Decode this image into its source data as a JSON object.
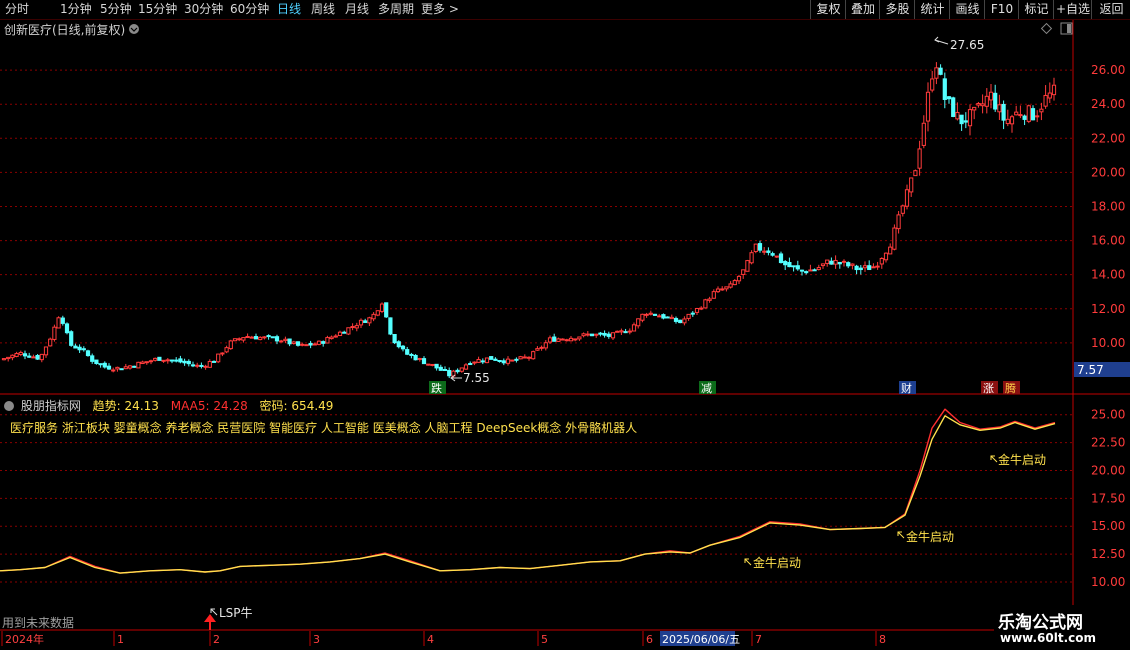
{
  "toolbar": {
    "periods": [
      {
        "label": "分时",
        "active": false
      },
      {
        "label": "1分钟",
        "active": false
      },
      {
        "label": "5分钟",
        "active": false
      },
      {
        "label": "15分钟",
        "active": false
      },
      {
        "label": "30分钟",
        "active": false
      },
      {
        "label": "60分钟",
        "active": false
      },
      {
        "label": "日线",
        "active": true
      },
      {
        "label": "周线",
        "active": false
      },
      {
        "label": "月线",
        "active": false
      },
      {
        "label": "多周期",
        "active": false
      },
      {
        "label": "更多 >",
        "active": false
      }
    ],
    "right_buttons": [
      "复权",
      "叠加",
      "多股",
      "统计",
      "画线",
      "F10",
      "标记",
      "+自选",
      "返回"
    ]
  },
  "main_chart": {
    "title": "创新医疗(日线,前复权)",
    "price_ticks": [
      "26.00",
      "24.00",
      "22.00",
      "20.00",
      "18.00",
      "16.00",
      "14.00",
      "12.00",
      "10.00"
    ],
    "high_annotation": "27.65",
    "low_annotation": "7.55",
    "current_price": "7.57",
    "markers": [
      "跌",
      "减",
      "财",
      "涨",
      "腾"
    ]
  },
  "indicator": {
    "name": "股朋指标网",
    "trend_label": "趋势:",
    "trend_value": "24.13",
    "maa5_label": "MAA5:",
    "maa5_value": "24.28",
    "code_label": "密码:",
    "code_value": "654.49",
    "concepts": "医疗服务 浙江板块 婴童概念 养老概念 民营医院 智能医疗 人工智能 医美概念 人脑工程 DeepSeek概念 外骨骼机器人",
    "ticks": [
      "25.00",
      "22.50",
      "20.00",
      "17.50",
      "15.00",
      "12.50",
      "10.00"
    ],
    "signals": [
      "金牛启动",
      "金牛启动",
      "金牛启动",
      "LSP牛"
    ],
    "future_note": "用到未来数据"
  },
  "timeline": {
    "labels": [
      "2024年",
      "1",
      "2",
      "3",
      "4",
      "5",
      "6",
      "7",
      "8"
    ],
    "selected_date": "2025/06/06/五"
  },
  "watermark": {
    "site_name": "乐淘公式网",
    "site_url": "www.60lt.com"
  },
  "colors": {
    "up": "#ff3b3b",
    "down": "#54ffff",
    "grid": "#7a0000",
    "trend": "#ffe14d",
    "maa5": "#ff3030",
    "price_box": "#1f3f8f"
  },
  "chart_data": [
    {
      "type": "candlestick",
      "title": "创新医疗(日线,前复权)",
      "ylim": [
        7.0,
        28.0
      ],
      "ticks": [
        10,
        12,
        14,
        16,
        18,
        20,
        22,
        24,
        26
      ],
      "close_path": [
        [
          0,
          9.0
        ],
        [
          20,
          9.4
        ],
        [
          40,
          9.1
        ],
        [
          52,
          10.5
        ],
        [
          60,
          11.8
        ],
        [
          70,
          9.9
        ],
        [
          82,
          9.6
        ],
        [
          92,
          9.0
        ],
        [
          104,
          8.6
        ],
        [
          120,
          8.5
        ],
        [
          140,
          8.8
        ],
        [
          160,
          9.1
        ],
        [
          180,
          8.9
        ],
        [
          200,
          8.6
        ],
        [
          215,
          9.0
        ],
        [
          230,
          10.0
        ],
        [
          245,
          10.4
        ],
        [
          262,
          10.3
        ],
        [
          280,
          10.2
        ],
        [
          300,
          9.8
        ],
        [
          320,
          10.0
        ],
        [
          340,
          10.6
        ],
        [
          360,
          11.2
        ],
        [
          372,
          11.5
        ],
        [
          382,
          12.4
        ],
        [
          392,
          10.3
        ],
        [
          405,
          9.4
        ],
        [
          420,
          9.0
        ],
        [
          435,
          8.6
        ],
        [
          450,
          8.1
        ],
        [
          470,
          8.9
        ],
        [
          490,
          9.1
        ],
        [
          510,
          8.9
        ],
        [
          530,
          9.2
        ],
        [
          550,
          10.2
        ],
        [
          570,
          10.3
        ],
        [
          590,
          10.5
        ],
        [
          610,
          10.4
        ],
        [
          630,
          10.8
        ],
        [
          645,
          11.8
        ],
        [
          660,
          11.6
        ],
        [
          680,
          11.2
        ],
        [
          700,
          12.1
        ],
        [
          715,
          13.0
        ],
        [
          730,
          13.3
        ],
        [
          745,
          14.3
        ],
        [
          755,
          15.6
        ],
        [
          770,
          15.4
        ],
        [
          785,
          14.6
        ],
        [
          800,
          14.2
        ],
        [
          815,
          14.3
        ],
        [
          830,
          14.8
        ],
        [
          845,
          14.6
        ],
        [
          860,
          14.3
        ],
        [
          875,
          14.5
        ],
        [
          890,
          15.8
        ],
        [
          905,
          18.4
        ],
        [
          915,
          20.2
        ],
        [
          925,
          23.4
        ],
        [
          935,
          26.8
        ],
        [
          945,
          24.3
        ],
        [
          960,
          23.0
        ],
        [
          975,
          23.4
        ],
        [
          990,
          24.6
        ],
        [
          1005,
          23.0
        ],
        [
          1020,
          23.6
        ],
        [
          1035,
          23.4
        ],
        [
          1045,
          24.3
        ],
        [
          1056,
          24.8
        ]
      ],
      "high": 27.65,
      "low": 7.55,
      "last": 7.57
    },
    {
      "type": "line",
      "title": "股朋指标网",
      "ylim": [
        10.0,
        26.5
      ],
      "ticks": [
        10,
        12.5,
        15,
        17.5,
        20,
        22.5,
        25
      ],
      "series": [
        {
          "name": "趋势",
          "color": "#ffe14d",
          "points": [
            [
              0,
              11.0
            ],
            [
              20,
              11.1
            ],
            [
              45,
              11.3
            ],
            [
              70,
              12.2
            ],
            [
              95,
              11.3
            ],
            [
              120,
              10.8
            ],
            [
              150,
              11.0
            ],
            [
              180,
              11.1
            ],
            [
              205,
              10.9
            ],
            [
              220,
              11.0
            ],
            [
              240,
              11.4
            ],
            [
              270,
              11.5
            ],
            [
              300,
              11.6
            ],
            [
              330,
              11.8
            ],
            [
              360,
              12.1
            ],
            [
              385,
              12.5
            ],
            [
              410,
              11.8
            ],
            [
              440,
              11.0
            ],
            [
              470,
              11.1
            ],
            [
              500,
              11.3
            ],
            [
              530,
              11.2
            ],
            [
              560,
              11.5
            ],
            [
              590,
              11.8
            ],
            [
              620,
              11.9
            ],
            [
              645,
              12.5
            ],
            [
              670,
              12.7
            ],
            [
              690,
              12.6
            ],
            [
              710,
              13.3
            ],
            [
              740,
              14.0
            ],
            [
              770,
              15.3
            ],
            [
              800,
              15.1
            ],
            [
              830,
              14.7
            ],
            [
              860,
              14.8
            ],
            [
              885,
              14.9
            ],
            [
              905,
              16.0
            ],
            [
              920,
              19.5
            ],
            [
              932,
              22.8
            ],
            [
              945,
              24.9
            ],
            [
              960,
              24.1
            ],
            [
              980,
              23.6
            ],
            [
              1000,
              23.8
            ],
            [
              1015,
              24.3
            ],
            [
              1035,
              23.7
            ],
            [
              1055,
              24.2
            ]
          ]
        },
        {
          "name": "MAA5",
          "color": "#ff3030",
          "points": [
            [
              0,
              11.0
            ],
            [
              20,
              11.1
            ],
            [
              45,
              11.3
            ],
            [
              70,
              12.3
            ],
            [
              95,
              11.4
            ],
            [
              120,
              10.8
            ],
            [
              150,
              11.0
            ],
            [
              180,
              11.1
            ],
            [
              205,
              10.9
            ],
            [
              220,
              11.0
            ],
            [
              240,
              11.4
            ],
            [
              270,
              11.5
            ],
            [
              300,
              11.6
            ],
            [
              330,
              11.8
            ],
            [
              360,
              12.1
            ],
            [
              385,
              12.6
            ],
            [
              410,
              11.9
            ],
            [
              440,
              11.0
            ],
            [
              470,
              11.1
            ],
            [
              500,
              11.3
            ],
            [
              530,
              11.2
            ],
            [
              560,
              11.5
            ],
            [
              590,
              11.8
            ],
            [
              620,
              11.9
            ],
            [
              645,
              12.5
            ],
            [
              670,
              12.8
            ],
            [
              690,
              12.6
            ],
            [
              710,
              13.3
            ],
            [
              740,
              14.1
            ],
            [
              770,
              15.4
            ],
            [
              800,
              15.2
            ],
            [
              830,
              14.7
            ],
            [
              860,
              14.8
            ],
            [
              885,
              14.9
            ],
            [
              905,
              16.1
            ],
            [
              920,
              20.0
            ],
            [
              932,
              23.8
            ],
            [
              945,
              25.5
            ],
            [
              960,
              24.3
            ],
            [
              980,
              23.7
            ],
            [
              1000,
              23.9
            ],
            [
              1015,
              24.4
            ],
            [
              1035,
              23.8
            ],
            [
              1055,
              24.3
            ]
          ]
        }
      ],
      "signals": [
        {
          "label": "金牛启动",
          "x": 1000,
          "y": 22.5
        },
        {
          "label": "金牛启动",
          "x": 905,
          "y": 15.6
        },
        {
          "label": "金牛启动",
          "x": 750,
          "y": 13.4
        },
        {
          "label": "LSP牛",
          "x": 214,
          "y": 11.0
        }
      ]
    }
  ]
}
